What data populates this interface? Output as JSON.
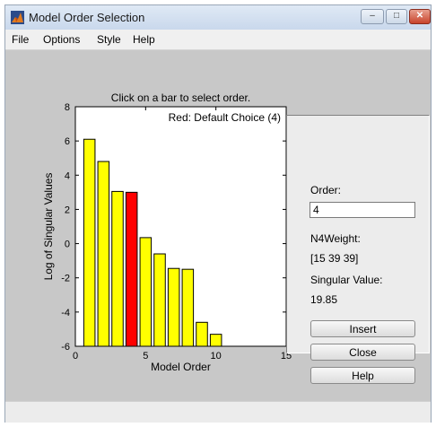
{
  "window": {
    "title": "Model Order Selection",
    "minimize_glyph": "–",
    "maximize_glyph": "□",
    "close_glyph": "✕"
  },
  "menu": [
    "File",
    "Options",
    "Style",
    "Help"
  ],
  "right_panel": {
    "order_label": "Order:",
    "order_value": "4",
    "n4weight_label": "N4Weight:",
    "n4weight_value": "[15 39 39]",
    "singular_label": "Singular Value:",
    "singular_value": "19.85",
    "insert_label": "Insert",
    "close_label": "Close",
    "help_label": "Help"
  },
  "colors": {
    "bar_default": "#ffff00",
    "bar_selected": "#ff0000",
    "annotation": "#000000"
  },
  "chart_data": {
    "type": "bar",
    "title": "Click on a bar to select order.",
    "xlabel": "Model Order",
    "ylabel": "Log of Singular Values",
    "annotation": "Red: Default Choice (4)",
    "xlim": [
      0,
      15
    ],
    "ylim": [
      -6,
      8
    ],
    "xticks": [
      0,
      5,
      10,
      15
    ],
    "yticks": [
      -6,
      -4,
      -2,
      0,
      2,
      4,
      6,
      8
    ],
    "grid": false,
    "baseline": -6,
    "selected_order": 4,
    "x": [
      1,
      2,
      3,
      4,
      5,
      6,
      7,
      8,
      9,
      10
    ],
    "values": [
      6.1,
      4.8,
      3.05,
      3.0,
      0.35,
      -0.6,
      -1.45,
      -1.5,
      -4.6,
      -5.3
    ]
  }
}
